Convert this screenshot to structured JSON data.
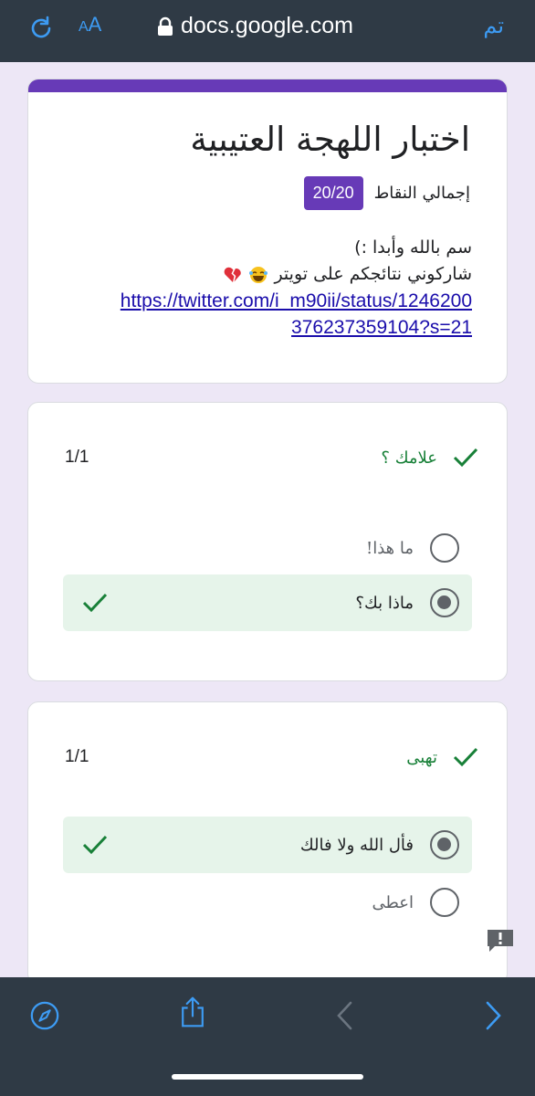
{
  "browser": {
    "aa_small": "A",
    "aa_large": "A",
    "url": "docs.google.com",
    "done_label": "تم"
  },
  "form": {
    "title": "اختبار اللهجة العتيبية",
    "points_label": "إجمالي النقاط",
    "points_value": "20/20",
    "description_line1": "سم بالله وأبدا :)",
    "description_line2": "شاركوني نتائجكم على تويتر",
    "link_line1": "https://twitter.com/i_m90ii/status/1246200",
    "link_line2": "376237359104?s=21"
  },
  "questions": [
    {
      "title": "علامك ؟",
      "score": "1/1",
      "options": [
        {
          "label": "ما هذا!",
          "selected": false,
          "correct": false
        },
        {
          "label": "ماذا بك؟",
          "selected": true,
          "correct": true
        }
      ]
    },
    {
      "title": "تهبى",
      "score": "1/1",
      "options": [
        {
          "label": "فأل الله ولا فالك",
          "selected": true,
          "correct": true
        },
        {
          "label": "اعطى",
          "selected": false,
          "correct": false
        }
      ]
    }
  ],
  "icons": {
    "refresh": "refresh-icon",
    "lock": "lock-icon",
    "check": "check-icon",
    "feedback": "feedback-icon",
    "compass": "compass-icon",
    "share": "share-icon",
    "back": "chevron-left-icon",
    "forward": "chevron-right-icon"
  },
  "colors": {
    "accent": "#673ab7",
    "correct_green": "#188038",
    "correct_bg": "#e6f4ea",
    "browser_blue": "#3d9bf3",
    "toolbar": "#2f3a45"
  }
}
